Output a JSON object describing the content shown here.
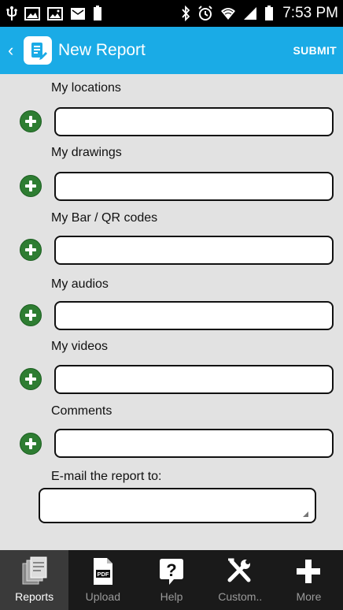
{
  "status_bar": {
    "time": "7:53 PM",
    "left_icons": [
      "usb-icon",
      "image-icon",
      "gallery-icon",
      "message-icon",
      "battery-full-icon"
    ],
    "right_icons": [
      "bluetooth-icon",
      "alarm-icon",
      "wifi-icon",
      "signal-icon",
      "battery-icon"
    ]
  },
  "action_bar": {
    "title": "New Report",
    "submit_label": "SUBMIT",
    "color": "#1aabe6"
  },
  "form": {
    "fields": [
      {
        "label": "My locations",
        "value": ""
      },
      {
        "label": "My drawings",
        "value": ""
      },
      {
        "label": "My Bar / QR codes",
        "value": ""
      },
      {
        "label": "My audios",
        "value": ""
      },
      {
        "label": "My videos",
        "value": ""
      },
      {
        "label": "Comments",
        "value": ""
      }
    ],
    "email_label": "E-mail the report to:",
    "email_value": ""
  },
  "bottom_nav": {
    "items": [
      {
        "label": "Reports",
        "icon": "reports-icon",
        "active": true
      },
      {
        "label": "Upload",
        "icon": "pdf-upload-icon",
        "active": false
      },
      {
        "label": "Help",
        "icon": "help-icon",
        "active": false
      },
      {
        "label": "Custom..",
        "icon": "tools-icon",
        "active": false
      },
      {
        "label": "More",
        "icon": "plus-icon",
        "active": false
      }
    ]
  }
}
